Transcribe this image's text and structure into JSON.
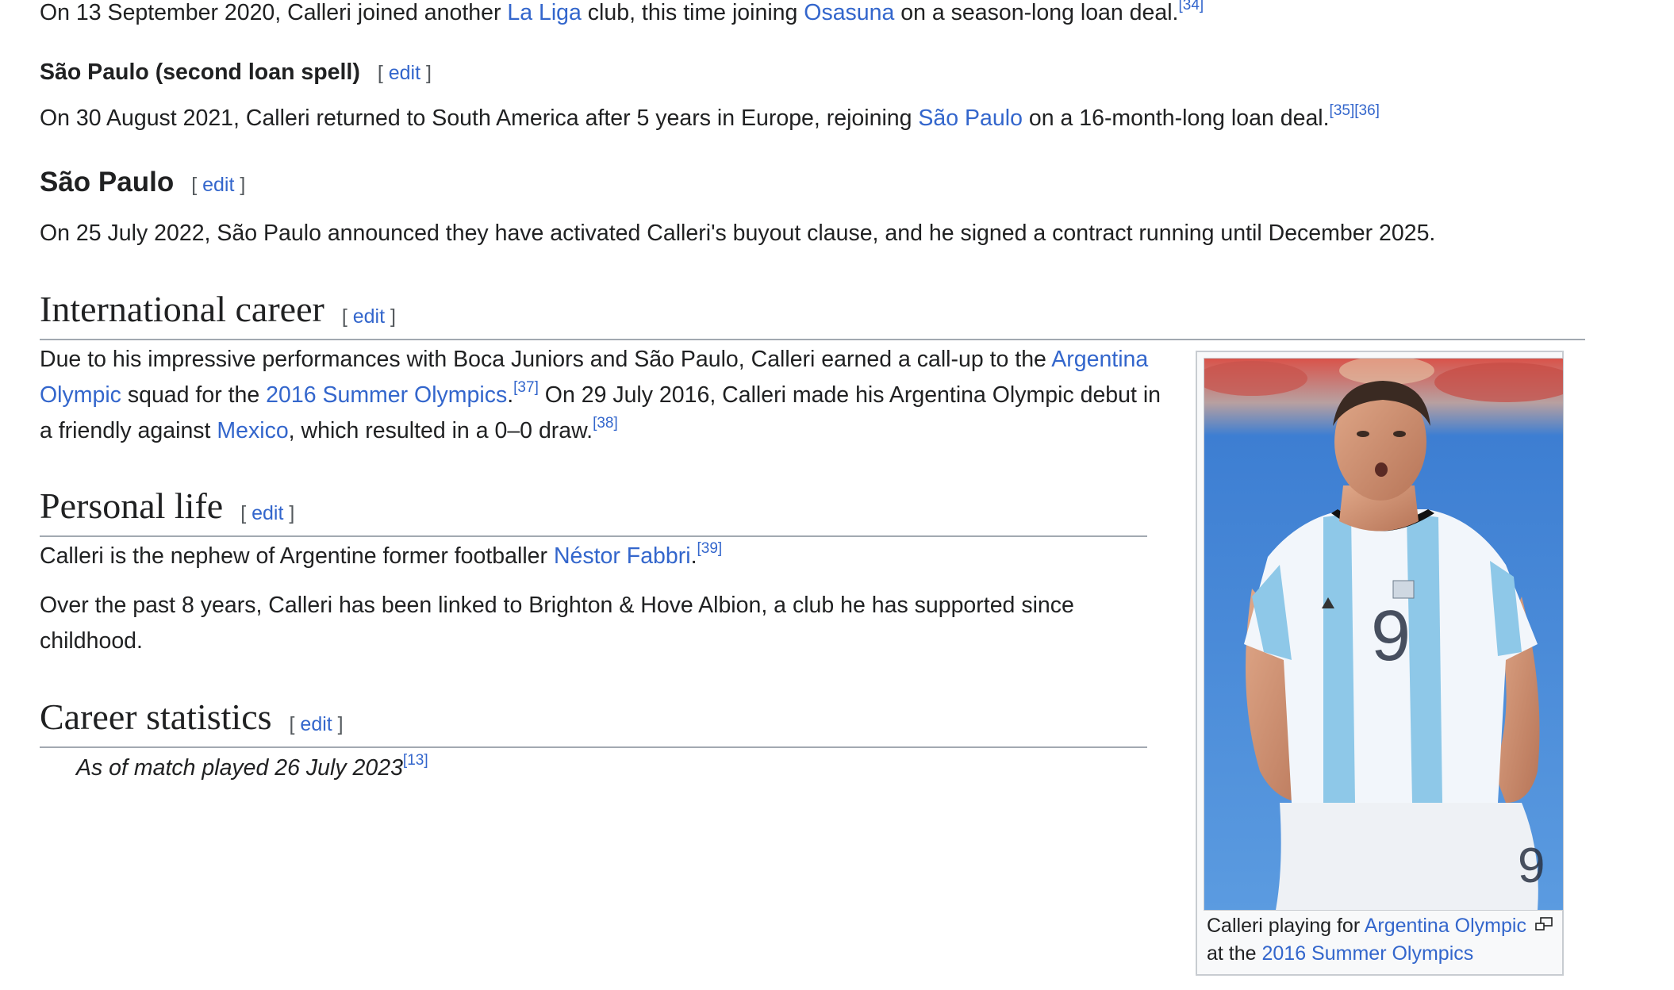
{
  "osasuna_para": {
    "t1": "On 13 September 2020, Calleri joined another ",
    "link1": "La Liga",
    "t2": " club, this time joining ",
    "link2": "Osasuna",
    "t3": " on a season-long loan deal.",
    "ref": "[34]"
  },
  "sp_loan": {
    "heading": "São Paulo (second loan spell)",
    "edit_open": "[ ",
    "edit_label": "edit",
    "edit_close": " ]",
    "t1": "On 30 August 2021, Calleri returned to South America after 5 years in Europe, rejoining ",
    "link1": "São Paulo",
    "t2": " on a 16-month-long loan deal.",
    "ref1": "[35]",
    "ref2": "[36]"
  },
  "sp": {
    "heading": "São Paulo",
    "edit_label": "edit",
    "text": "On 25 July 2022, São Paulo announced they have activated Calleri's buyout clause, and he signed a contract running until December 2025."
  },
  "international": {
    "heading": "International career",
    "edit_label": "edit",
    "t1": "Due to his impressive performances with Boca Juniors and São Paulo, Calleri earned a call-up to the ",
    "link1": "Argentina Olympic",
    "t2": " squad for the ",
    "link2": "2016 Summer Olympics",
    "t3": ".",
    "ref1": "[37]",
    "t4": " On 29 July 2016, Calleri made his Argentina Olympic debut in a friendly against ",
    "link3": "Mexico",
    "t5": ", which resulted in a 0–0 draw.",
    "ref2": "[38]"
  },
  "personal": {
    "heading": "Personal life",
    "edit_label": "edit",
    "p1_t1": "Calleri is the nephew of Argentine former footballer ",
    "p1_link": "Néstor Fabbri",
    "p1_t2": ".",
    "p1_ref": "[39]",
    "p2": "Over the past 8 years, Calleri has been linked to Brighton & Hove Albion, a club he has supported since childhood."
  },
  "career": {
    "heading": "Career statistics",
    "edit_label": "edit",
    "note": "As of match played 26 July 2023",
    "note_ref": "[13]"
  },
  "thumbnail": {
    "caption_t1": "Calleri playing for ",
    "caption_link1": "Argentina Olympic",
    "caption_t2": " at the ",
    "caption_link2": "2016 Summer Olympics",
    "jersey_number": "9",
    "shorts_number": "9"
  },
  "icons": {
    "enlarge": "magnify-clip-icon"
  },
  "colors": {
    "link": "#3366cc",
    "text": "#202122",
    "heading_rule": "#a2a9b1"
  }
}
